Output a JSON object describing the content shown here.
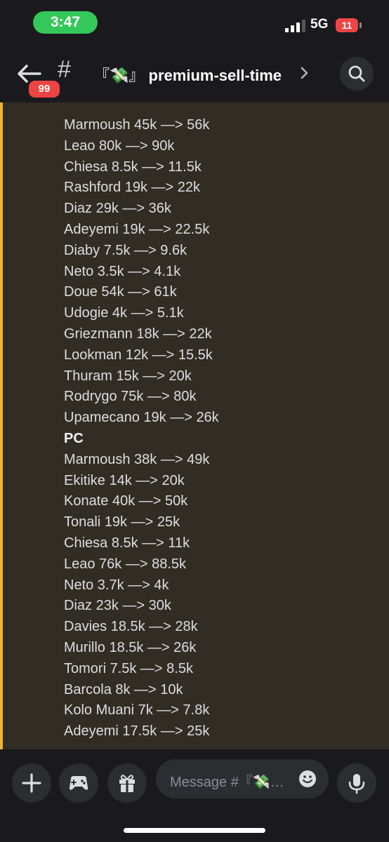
{
  "status_bar": {
    "time": "3:47",
    "network": "5G",
    "battery": "11",
    "time_color": "#34c759",
    "battery_color": "#ef4444"
  },
  "header": {
    "unread_badge": "99",
    "channel_prefix_icon": "hash-icon",
    "channel_name": "premium-sell-time",
    "channel_emoji": "『💸』"
  },
  "messages": {
    "accent_color": "#f0b232",
    "lines": [
      {
        "text": "Marmoush 45k —> 56k",
        "heading": false
      },
      {
        "text": "Leao 80k —> 90k",
        "heading": false
      },
      {
        "text": "Chiesa 8.5k —> 11.5k",
        "heading": false
      },
      {
        "text": "Rashford 19k —> 22k",
        "heading": false
      },
      {
        "text": "Diaz 29k —> 36k",
        "heading": false
      },
      {
        "text": "Adeyemi 19k —> 22.5k",
        "heading": false
      },
      {
        "text": "Diaby 7.5k —> 9.6k",
        "heading": false
      },
      {
        "text": "Neto 3.5k —> 4.1k",
        "heading": false
      },
      {
        "text": "Doue 54k —> 61k",
        "heading": false
      },
      {
        "text": "Udogie 4k —> 5.1k",
        "heading": false
      },
      {
        "text": "Griezmann 18k —> 22k",
        "heading": false
      },
      {
        "text": "Lookman 12k —> 15.5k",
        "heading": false
      },
      {
        "text": "Thuram 15k —> 20k",
        "heading": false
      },
      {
        "text": "Rodrygo 75k —> 80k",
        "heading": false
      },
      {
        "text": "Upamecano 19k —> 26k",
        "heading": false
      },
      {
        "text": "PC",
        "heading": true
      },
      {
        "text": "Marmoush 38k —> 49k",
        "heading": false
      },
      {
        "text": "Ekitike 14k —> 20k",
        "heading": false
      },
      {
        "text": "Konate 40k —> 50k",
        "heading": false
      },
      {
        "text": "Tonali 19k —> 25k",
        "heading": false
      },
      {
        "text": "Chiesa 8.5k —> 11k",
        "heading": false
      },
      {
        "text": "Leao 76k —> 88.5k",
        "heading": false
      },
      {
        "text": "Neto 3.7k —> 4k",
        "heading": false
      },
      {
        "text": "Diaz 23k —> 30k",
        "heading": false
      },
      {
        "text": "Davies 18.5k —> 28k",
        "heading": false
      },
      {
        "text": "Murillo 18.5k —> 26k",
        "heading": false
      },
      {
        "text": "Tomori 7.5k —> 8.5k",
        "heading": false
      },
      {
        "text": "Barcola 8k —> 10k",
        "heading": false
      },
      {
        "text": "Kolo Muani 7k —> 7.8k",
        "heading": false
      },
      {
        "text": "Adeyemi 17.5k —> 25k",
        "heading": false
      }
    ]
  },
  "composer": {
    "placeholder": "Message #『💸…",
    "buttons": [
      "plus-icon",
      "gamepad-icon",
      "gift-icon",
      "emoji-icon",
      "microphone-icon"
    ]
  }
}
